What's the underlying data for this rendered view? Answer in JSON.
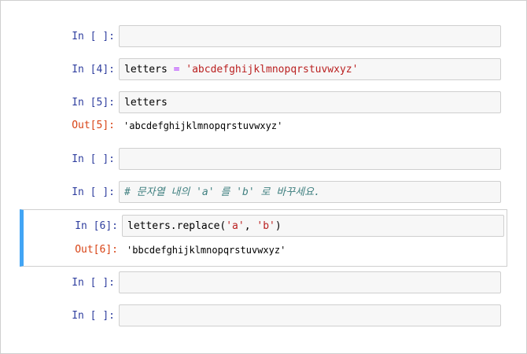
{
  "cells": [
    {
      "prompt": "In [ ]:",
      "code": ""
    },
    {
      "prompt": "In [4]:",
      "code_var": "letters",
      "code_op": " = ",
      "code_str": "'abcdefghijklmnopqrstuvwxyz'"
    },
    {
      "prompt": "In [5]:",
      "code": "letters",
      "out_prompt": "Out[5]:",
      "output": "'abcdefghijklmnopqrstuvwxyz'"
    },
    {
      "prompt": "In [ ]:",
      "code": ""
    },
    {
      "prompt": "In [ ]:",
      "comment": "# 문자열 내의 'a' 를 'b' 로 바꾸세요."
    },
    {
      "prompt": "In [6]:",
      "code_pre": "letters.replace(",
      "code_arg1": "'a'",
      "code_sep": ", ",
      "code_arg2": "'b'",
      "code_post": ")",
      "out_prompt": "Out[6]:",
      "output": "'bbcdefghijklmnopqrstuvwxyz'"
    },
    {
      "prompt": "In [ ]:",
      "code": ""
    },
    {
      "prompt": "In [ ]:",
      "code": ""
    }
  ],
  "colors": {
    "in_prompt": "#303f9f",
    "out_prompt": "#d84315",
    "selected_border": "#42a5f5",
    "string": "#ba2121",
    "operator": "#aa22ff",
    "comment": "#408080"
  }
}
